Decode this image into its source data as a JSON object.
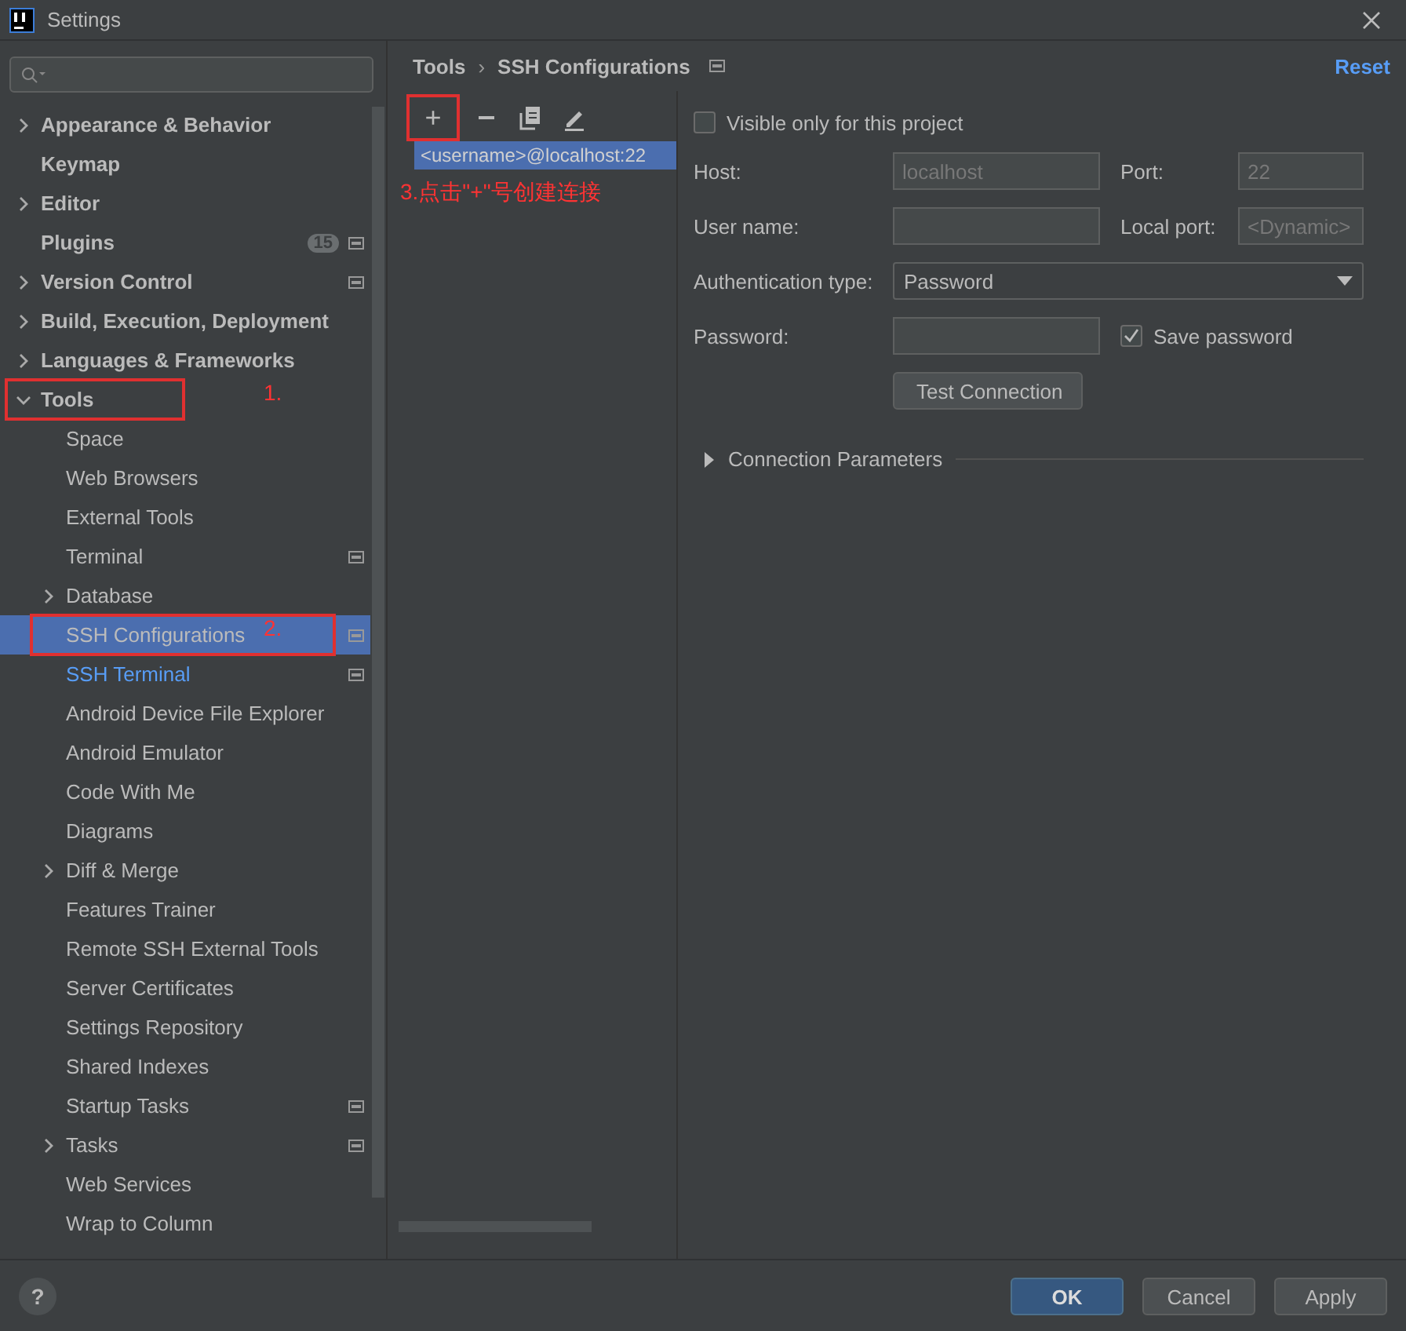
{
  "window": {
    "title": "Settings"
  },
  "sidebar": {
    "items": [
      {
        "label": "Appearance & Behavior",
        "expandable": true,
        "expanded": false,
        "selected": false,
        "accent": false,
        "project_icon": false
      },
      {
        "label": "Keymap",
        "expandable": false,
        "selected": false,
        "accent": false,
        "project_icon": false
      },
      {
        "label": "Editor",
        "expandable": true,
        "expanded": false,
        "selected": false,
        "accent": false,
        "project_icon": false
      },
      {
        "label": "Plugins",
        "expandable": false,
        "selected": false,
        "accent": false,
        "project_icon": true,
        "badge": "15"
      },
      {
        "label": "Version Control",
        "expandable": true,
        "expanded": false,
        "selected": false,
        "accent": false,
        "project_icon": true
      },
      {
        "label": "Build, Execution, Deployment",
        "expandable": true,
        "expanded": false,
        "selected": false,
        "accent": false,
        "project_icon": false
      },
      {
        "label": "Languages & Frameworks",
        "expandable": true,
        "expanded": false,
        "selected": false,
        "accent": false,
        "project_icon": false
      },
      {
        "label": "Tools",
        "expandable": true,
        "expanded": true,
        "selected": false,
        "accent": false,
        "project_icon": false,
        "annotation": "1.",
        "children": [
          {
            "label": "Space",
            "expandable": false,
            "selected": false,
            "accent": false,
            "project_icon": false
          },
          {
            "label": "Web Browsers",
            "expandable": false,
            "selected": false,
            "accent": false,
            "project_icon": false
          },
          {
            "label": "External Tools",
            "expandable": false,
            "selected": false,
            "accent": false,
            "project_icon": false
          },
          {
            "label": "Terminal",
            "expandable": false,
            "selected": false,
            "accent": false,
            "project_icon": true
          },
          {
            "label": "Database",
            "expandable": true,
            "expanded": false,
            "selected": false,
            "accent": false,
            "project_icon": false
          },
          {
            "label": "SSH Configurations",
            "expandable": false,
            "selected": true,
            "accent": false,
            "project_icon": true,
            "annotation": "2."
          },
          {
            "label": "SSH Terminal",
            "expandable": false,
            "selected": false,
            "accent": true,
            "project_icon": true
          },
          {
            "label": "Android Device File Explorer",
            "expandable": false,
            "selected": false,
            "accent": false,
            "project_icon": false
          },
          {
            "label": "Android Emulator",
            "expandable": false,
            "selected": false,
            "accent": false,
            "project_icon": false
          },
          {
            "label": "Code With Me",
            "expandable": false,
            "selected": false,
            "accent": false,
            "project_icon": false
          },
          {
            "label": "Diagrams",
            "expandable": false,
            "selected": false,
            "accent": false,
            "project_icon": false
          },
          {
            "label": "Diff & Merge",
            "expandable": true,
            "expanded": false,
            "selected": false,
            "accent": false,
            "project_icon": false
          },
          {
            "label": "Features Trainer",
            "expandable": false,
            "selected": false,
            "accent": false,
            "project_icon": false
          },
          {
            "label": "Remote SSH External Tools",
            "expandable": false,
            "selected": false,
            "accent": false,
            "project_icon": false
          },
          {
            "label": "Server Certificates",
            "expandable": false,
            "selected": false,
            "accent": false,
            "project_icon": false
          },
          {
            "label": "Settings Repository",
            "expandable": false,
            "selected": false,
            "accent": false,
            "project_icon": false
          },
          {
            "label": "Shared Indexes",
            "expandable": false,
            "selected": false,
            "accent": false,
            "project_icon": false
          },
          {
            "label": "Startup Tasks",
            "expandable": false,
            "selected": false,
            "accent": false,
            "project_icon": true
          },
          {
            "label": "Tasks",
            "expandable": true,
            "expanded": false,
            "selected": false,
            "accent": false,
            "project_icon": true
          },
          {
            "label": "Web Services",
            "expandable": false,
            "selected": false,
            "accent": false,
            "project_icon": false
          },
          {
            "label": "Wrap to Column",
            "expandable": false,
            "selected": false,
            "accent": false,
            "project_icon": false
          }
        ]
      }
    ]
  },
  "header": {
    "breadcrumb": [
      "Tools",
      "SSH Configurations"
    ],
    "separator": "›",
    "reset": "Reset"
  },
  "toolbar": {
    "add": "+",
    "annotation": "3.点击\"+\"号创建连接"
  },
  "configs": [
    {
      "label": "<username>@localhost:22",
      "selected": true
    }
  ],
  "form": {
    "visible_only": {
      "label": "Visible only for this project",
      "checked": false
    },
    "host": {
      "label": "Host:",
      "value": "localhost",
      "disabled": true
    },
    "port": {
      "label": "Port:",
      "value": "22",
      "disabled": true
    },
    "user": {
      "label": "User name:"
    },
    "local_port": {
      "label": "Local port:",
      "placeholder": "<Dynamic>"
    },
    "auth": {
      "label": "Authentication type:",
      "value": "Password"
    },
    "password": {
      "label": "Password:"
    },
    "save_password": {
      "label": "Save password",
      "checked": true
    },
    "test": "Test Connection",
    "params": {
      "label": "Connection Parameters",
      "expanded": false
    }
  },
  "footer": {
    "help": "?",
    "buttons": [
      {
        "label": "OK",
        "kind": "default"
      },
      {
        "label": "Cancel",
        "kind": "normal"
      },
      {
        "label": "Apply",
        "kind": "normal"
      }
    ]
  }
}
